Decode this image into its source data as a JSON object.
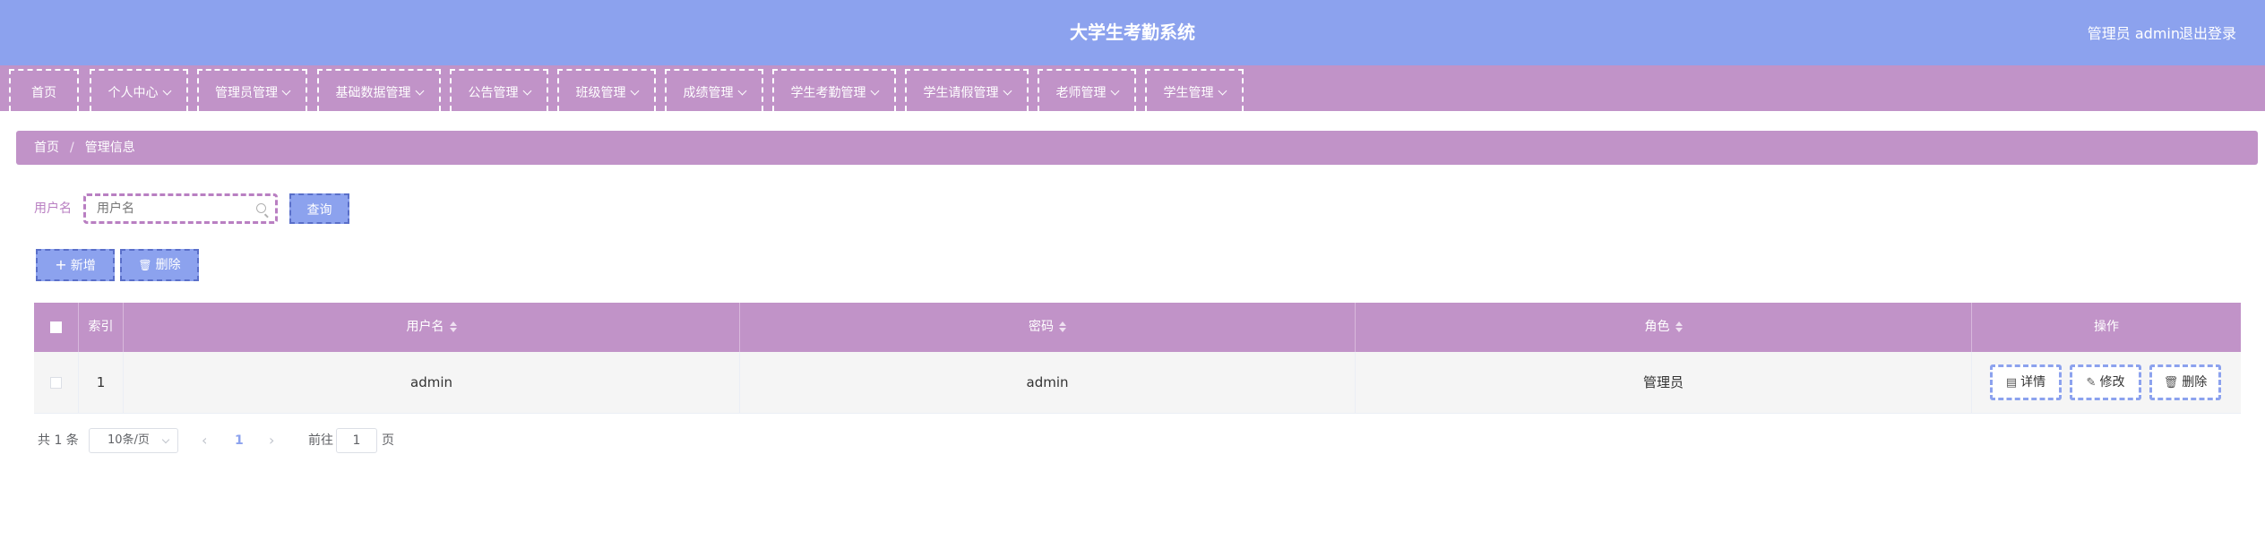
{
  "header": {
    "title": "大学生考勤系统",
    "user": "管理员 admin",
    "logout": "退出登录",
    "color": "#8ca2ee"
  },
  "nav": {
    "color": "#c193c8",
    "items": [
      {
        "label": "首页",
        "dropdown": false
      },
      {
        "label": "个人中心",
        "dropdown": true
      },
      {
        "label": "管理员管理",
        "dropdown": true
      },
      {
        "label": "基础数据管理",
        "dropdown": true
      },
      {
        "label": "公告管理",
        "dropdown": true
      },
      {
        "label": "班级管理",
        "dropdown": true
      },
      {
        "label": "成绩管理",
        "dropdown": true
      },
      {
        "label": "学生考勤管理",
        "dropdown": true
      },
      {
        "label": "学生请假管理",
        "dropdown": true
      },
      {
        "label": "老师管理",
        "dropdown": true
      },
      {
        "label": "学生管理",
        "dropdown": true
      }
    ]
  },
  "breadcrumb": {
    "home": "首页",
    "separator": "/",
    "current": "管理信息"
  },
  "search": {
    "label": "用户名",
    "placeholder": "用户名",
    "value": "",
    "query_label": "查询"
  },
  "actions": {
    "add_label": "新增",
    "delete_label": "删除"
  },
  "table": {
    "columns": [
      "索引",
      "用户名",
      "密码",
      "角色",
      "操作"
    ],
    "rows": [
      {
        "index": "1",
        "username": "admin",
        "password": "admin",
        "role": "管理员"
      }
    ],
    "row_actions": {
      "detail": "详情",
      "edit": "修改",
      "delete": "删除"
    }
  },
  "pagination": {
    "total_text": "共 1 条",
    "page_size": "10条/页",
    "current_page": "1",
    "goto_label": "前往",
    "goto_value": "1",
    "page_suffix": "页"
  }
}
